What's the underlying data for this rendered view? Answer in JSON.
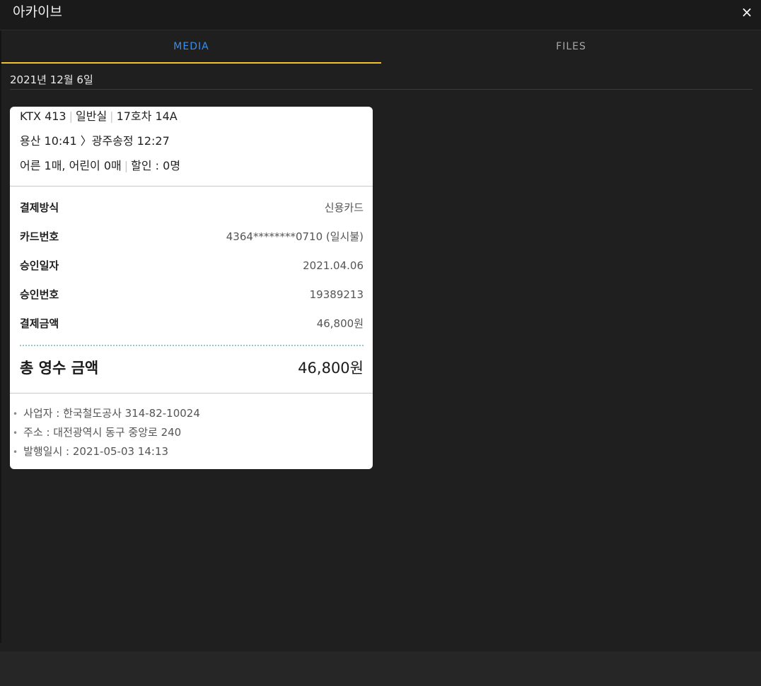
{
  "window": {
    "title": "아카이브",
    "close_label": "×"
  },
  "tabs": [
    {
      "label": "MEDIA",
      "active": true
    },
    {
      "label": "FILES",
      "active": false
    }
  ],
  "date_group": "2021년 12월 6일",
  "receipt": {
    "train_line": {
      "train": "KTX 413",
      "class": "일반실",
      "seat": "17호차 14A"
    },
    "route": "용산 10:41 〉광주송정 12:27",
    "passengers": {
      "counts": "어른 1매, 어린이 0매",
      "discount": "할인 : 0명"
    },
    "rows": [
      {
        "label": "결제방식",
        "value": "신용카드"
      },
      {
        "label": "카드번호",
        "value": "4364********0710 (일시불)"
      },
      {
        "label": "승인일자",
        "value": "2021.04.06"
      },
      {
        "label": "승인번호",
        "value": "19389213"
      },
      {
        "label": "결제금액",
        "value": "46,800원"
      }
    ],
    "total": {
      "label": "총 영수 금액",
      "value": "46,800원"
    },
    "notes": [
      "사업자 : 한국철도공사 314-82-10024",
      "주소 : 대전광역시 동구 중앙로 240",
      "발행일시 : 2021-05-03 14:13"
    ]
  },
  "colors": {
    "accent_tab_text": "#3b8ee8",
    "accent_underline": "#f2c230",
    "background": "#1f1f1f"
  }
}
